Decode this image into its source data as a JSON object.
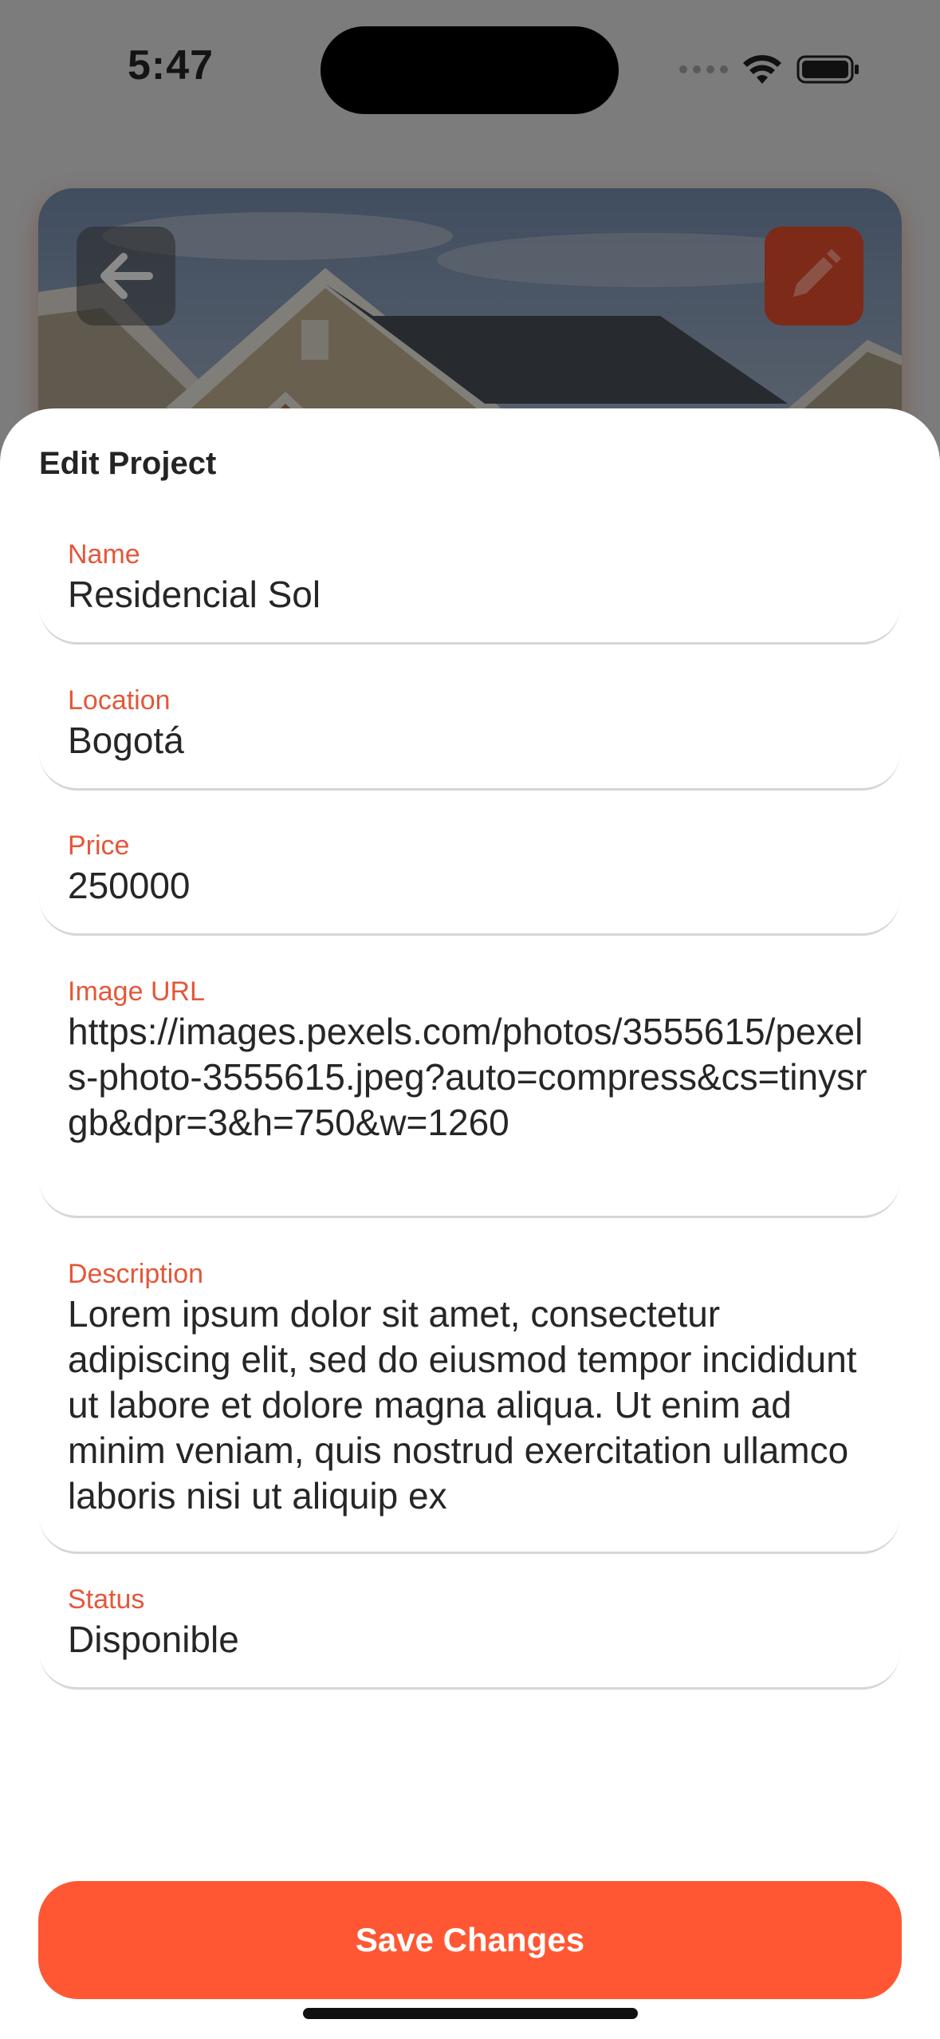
{
  "status_bar": {
    "time": "5:47"
  },
  "hero": {
    "image_description_icon": "house-photo",
    "back_icon": "arrow-left-icon",
    "edit_icon": "pencil-icon"
  },
  "sheet": {
    "title": "Edit Project",
    "fields": [
      {
        "label": "Name",
        "value": "Residencial Sol"
      },
      {
        "label": "Location",
        "value": "Bogotá"
      },
      {
        "label": "Price",
        "value": "250000"
      },
      {
        "label": "Image URL",
        "value": "https://images.pexels.com/photos/3555615/pexels-photo-3555615.jpeg?auto=compress&cs=tinysrgb&dpr=3&h=750&w=1260"
      },
      {
        "label": "Description",
        "value": "Lorem ipsum dolor sit amet, consectetur adipiscing elit, sed do eiusmod tempor incididunt ut labore et dolore magna aliqua. Ut enim ad minim veniam, quis nostrud exercitation ullamco laboris nisi ut aliquip ex"
      },
      {
        "label": "Status",
        "value": "Disponible"
      }
    ],
    "save_label": "Save Changes"
  },
  "colors": {
    "accent": "#ff5733",
    "label": "#e4573a"
  }
}
